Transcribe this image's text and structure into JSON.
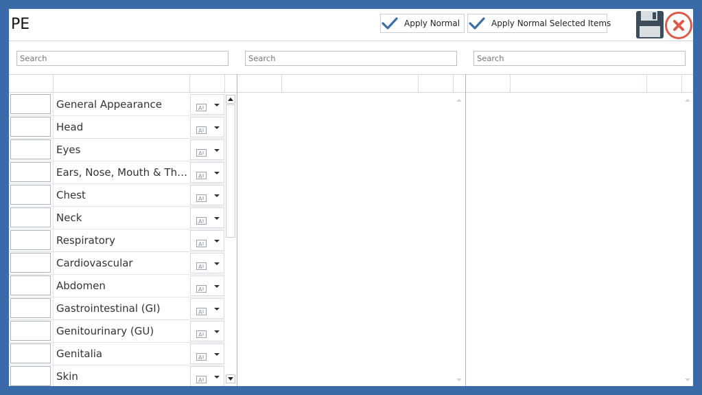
{
  "window": {
    "title": "PE"
  },
  "toolbar": {
    "apply_normal_label": "Apply Normal",
    "apply_normal_selected_label": "Apply Normal Selected Items",
    "check_icon": "check-icon",
    "save_icon": "floppy-disk-icon",
    "close_icon": "close-circle-icon"
  },
  "search": {
    "left_placeholder": "Search",
    "middle_placeholder": "Search",
    "right_placeholder": "Search"
  },
  "list": {
    "items": [
      {
        "label": "General Appearance"
      },
      {
        "label": "Head"
      },
      {
        "label": "Eyes"
      },
      {
        "label": "Ears, Nose, Mouth & Thr..."
      },
      {
        "label": "Chest"
      },
      {
        "label": "Neck"
      },
      {
        "label": "Respiratory"
      },
      {
        "label": "Cardiovascular"
      },
      {
        "label": "Abdomen"
      },
      {
        "label": "Gastrointestinal (GI)"
      },
      {
        "label": "Genitourinary (GU)"
      },
      {
        "label": "Genitalia"
      },
      {
        "label": "Skin"
      }
    ]
  },
  "colors": {
    "border": "#3a6aa8",
    "check": "#3d6ea8",
    "close_ring": "#e0584a",
    "save_icon": "#3c4c5a"
  }
}
